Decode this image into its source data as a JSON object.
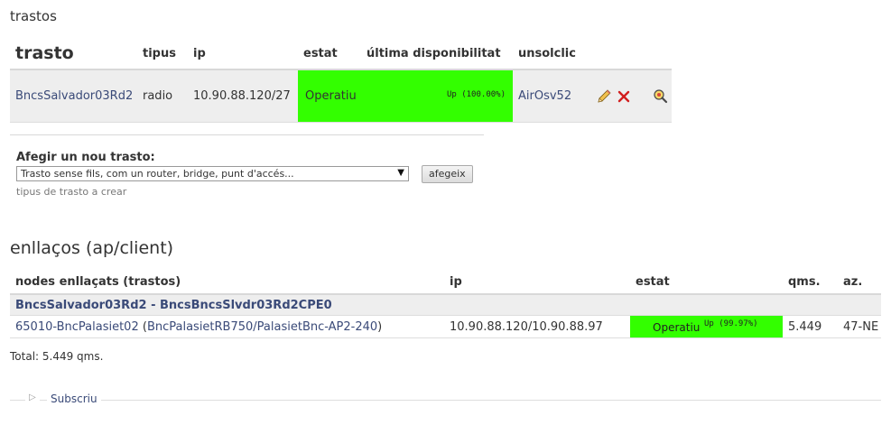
{
  "devices": {
    "title": "trastos",
    "headers": [
      "trasto",
      "tipus",
      "ip",
      "estat",
      "última disponibilitat",
      "unsolclic"
    ],
    "row": {
      "name": "BncsSalvador03Rd2",
      "type": "radio",
      "ip": "10.90.88.120/27",
      "status": "Operatiu",
      "availability": "Up (100.00%)",
      "unsolclic": "AirOsv52"
    },
    "status_color": "#33ff00"
  },
  "add_device": {
    "label": "Afegir un nou trasto:",
    "selected": "Trasto sense fils, com un router, bridge, punt d'accés...",
    "button": "afegeix",
    "help": "tipus de trasto a crear"
  },
  "links": {
    "title": "enllaços (ap/client)",
    "headers": [
      "nodes enllaçats (trastos)",
      "ip",
      "estat",
      "qms.",
      "az."
    ],
    "group": "BncsSalvador03Rd2 - BncsBncsSlvdr03Rd2CPE0",
    "row": {
      "node": "65010-BncPalasiet02",
      "node_paren_open": " (",
      "node_device": "BncPalasietRB750/PalasietBnc-AP2-240",
      "node_paren_close": ")",
      "ip": "10.90.88.120/10.90.88.97",
      "status": "Operatiu",
      "availability": "Up (99.97%)",
      "qms": "5.449",
      "az": "47-NE"
    }
  },
  "total": "Total: 5.449 qms.",
  "subscribe": "Subscriu",
  "icons": [
    "edit-icon",
    "delete-icon",
    "search-icon",
    "expand-triangle-icon"
  ]
}
